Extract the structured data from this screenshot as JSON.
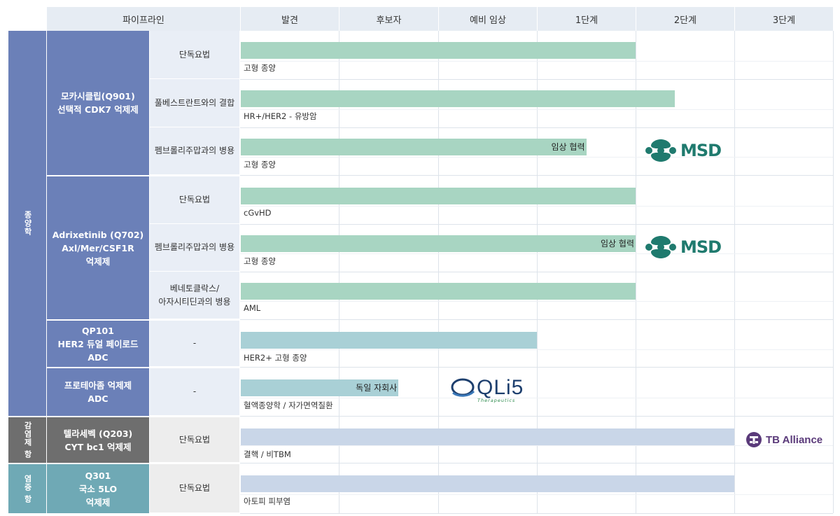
{
  "header": {
    "pipeline": "파이프라인",
    "stages": [
      "발견",
      "후보자",
      "예비 임상",
      "1단계",
      "2단계",
      "3단계"
    ]
  },
  "categories": [
    {
      "label": "종양학"
    },
    {
      "label": "감염제 항"
    },
    {
      "label": "염증 항"
    }
  ],
  "colors": {
    "header_bg": "#e6ecf3",
    "oncology_blue": "#6b80b8",
    "infection_gray": "#6e6e6e",
    "inflammation_teal": "#6fa9b5",
    "bar_green": "#a8d5c2",
    "bar_teal": "#a9d0d6",
    "bar_lavender": "#c9d6e8",
    "msd_green": "#1f7a6e",
    "tb_purple": "#5a3a7a"
  },
  "drugs": [
    {
      "lines": [
        "모카시클립(Q901)",
        "선택적 CDK7 억제제"
      ]
    },
    {
      "lines": [
        "Adrixetinib (Q702)",
        "Axl/Mer/CSF1R",
        "억제제"
      ]
    },
    {
      "lines": [
        "QP101",
        "HER2 듀얼 페이로드",
        "ADC"
      ]
    },
    {
      "lines": [
        "프로테아좀 억제제",
        "ADC"
      ]
    },
    {
      "lines": [
        "텔라세벡 (Q203)",
        "CYT bc1 억제제"
      ]
    },
    {
      "lines": [
        "Q301",
        "국소 5LO",
        "억제제"
      ]
    }
  ],
  "rows": [
    {
      "indication": [
        "단독요법"
      ],
      "target": "고형 종양",
      "bar_label": "",
      "progress_stage": 4.0
    },
    {
      "indication": [
        "풀베스트란트와의 결합"
      ],
      "target": "HR+/HER2 - 유방암",
      "bar_label": "",
      "progress_stage": 4.4
    },
    {
      "indication": [
        "펨브롤리주맙과의 병용"
      ],
      "target": "고형 종양",
      "bar_label": "임상 협력",
      "progress_stage": 3.5,
      "partner": "MSD"
    },
    {
      "indication": [
        "단독요법"
      ],
      "target": "cGvHD",
      "bar_label": "",
      "progress_stage": 4.0
    },
    {
      "indication": [
        "펨브롤리주맙과의 병용"
      ],
      "target": "고형 종양",
      "bar_label": "임상 협력",
      "progress_stage": 4.0,
      "partner": "MSD"
    },
    {
      "indication": [
        "베네토클락스/",
        "아자시티딘과의 병용"
      ],
      "target": "AML",
      "bar_label": "",
      "progress_stage": 4.0
    },
    {
      "indication": [
        "-"
      ],
      "target": "HER2+ 고형 종양",
      "bar_label": "",
      "progress_stage": 3.0
    },
    {
      "indication": [
        "-"
      ],
      "target": "혈액종양학 / 자가면역질환",
      "bar_label": "독일 자회사",
      "progress_stage": 1.6,
      "partner": "QLi5"
    },
    {
      "indication": [
        "단독요법"
      ],
      "target": "결핵 / 비TBM",
      "bar_label": "",
      "progress_stage": 5.0,
      "partner": "TB Alliance"
    },
    {
      "indication": [
        "단독요법"
      ],
      "target": "아토피 피부염",
      "bar_label": "",
      "progress_stage": 5.0
    }
  ],
  "partners": {
    "msd": "MSD",
    "qli5": "QLi5",
    "qli5_sub": "Therapeutics",
    "tb": "TB Alliance"
  }
}
